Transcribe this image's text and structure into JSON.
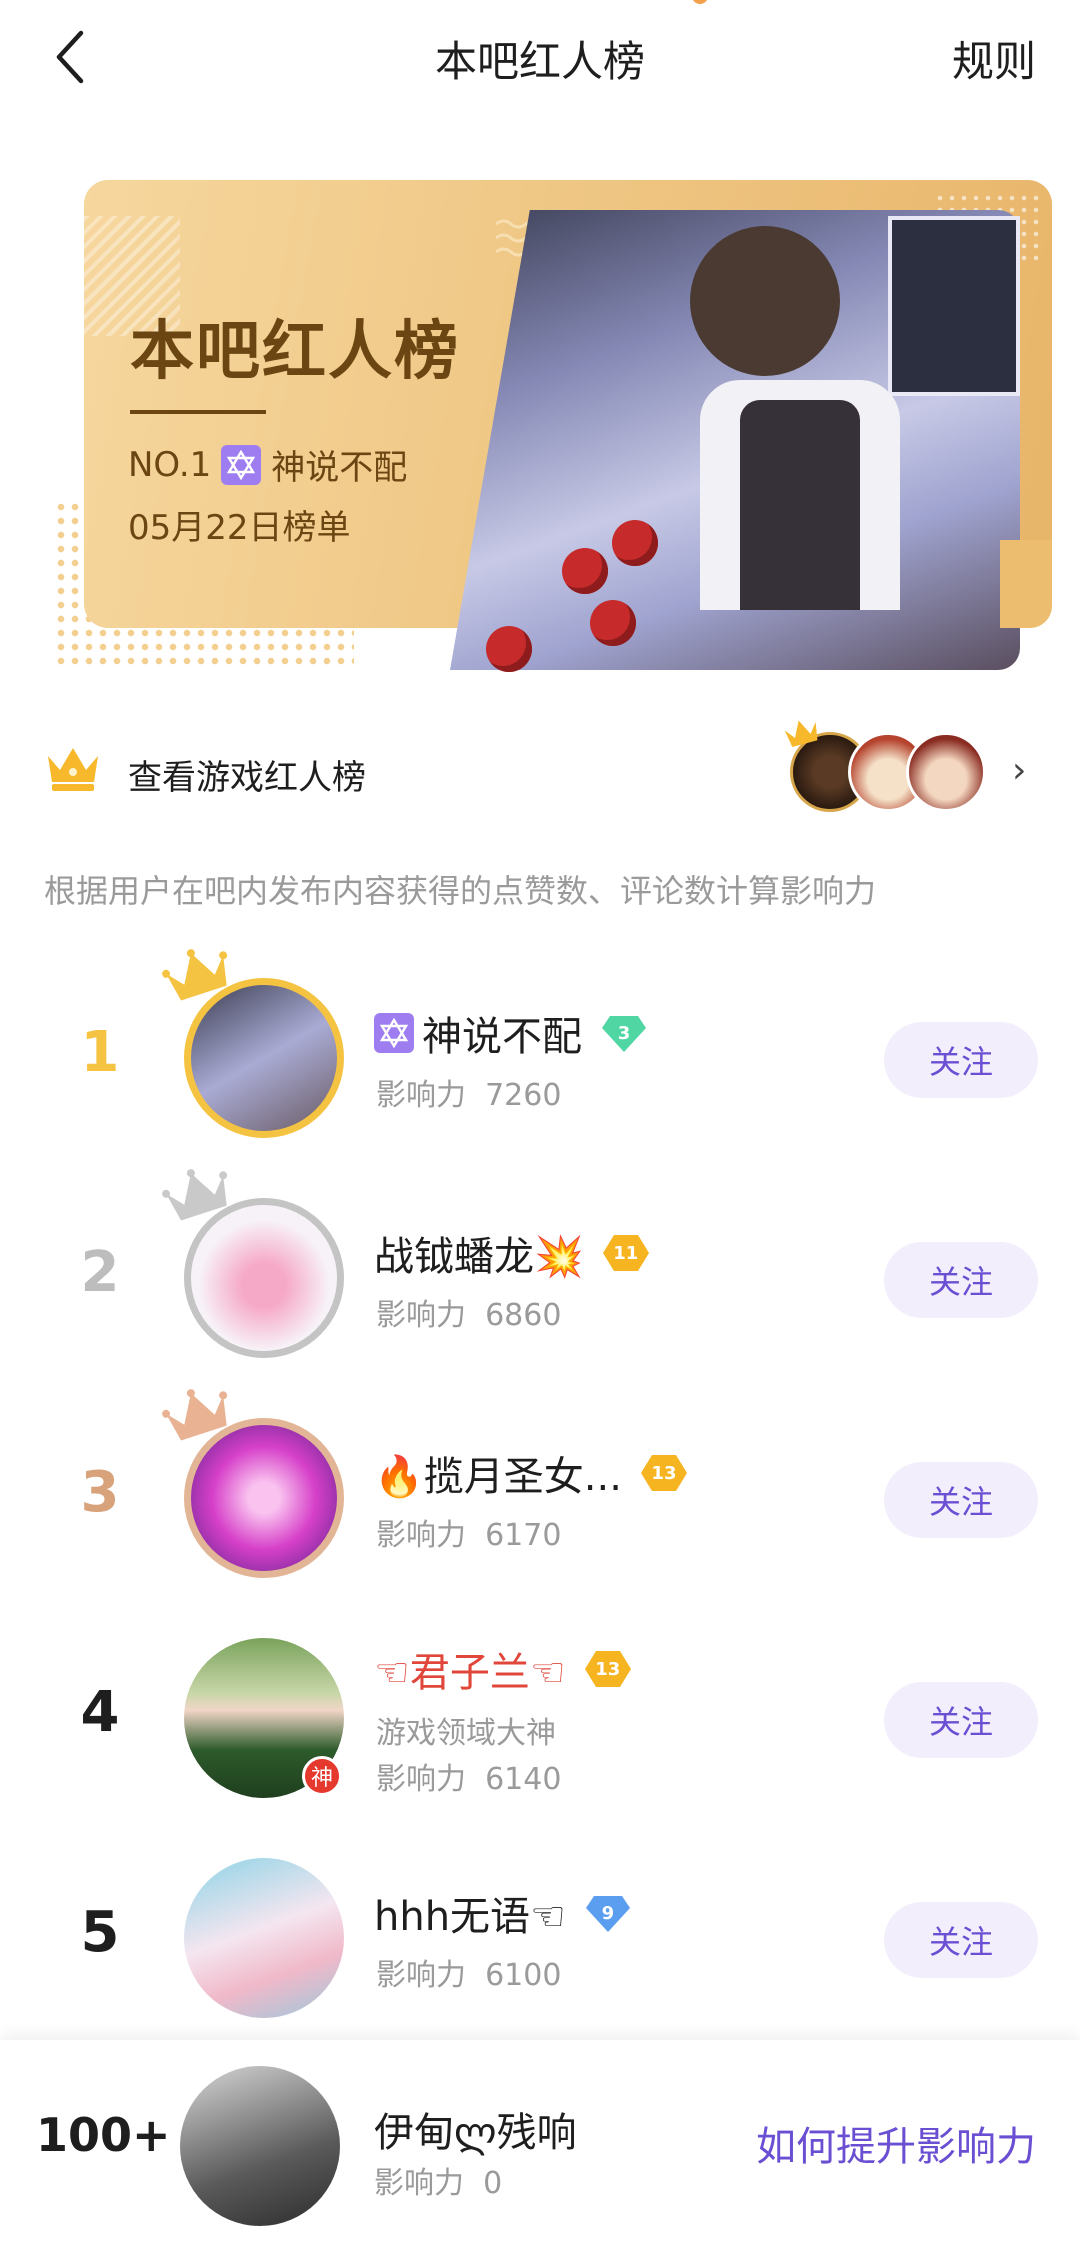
{
  "header": {
    "title": "本吧红人榜",
    "rules_label": "规则"
  },
  "banner": {
    "title": "本吧红人榜",
    "no1_prefix": "NO.1",
    "no1_name": "神说不配",
    "date": "05月22日榜单"
  },
  "game_rank": {
    "label": "查看游戏红人榜"
  },
  "description": "根据用户在吧内发布内容获得的点赞数、评论数计算影响力",
  "follow_label": "关注",
  "influence_label": "影响力",
  "ranking": [
    {
      "rank": "1",
      "name": "神说不配",
      "level": "3",
      "score": "7260",
      "rank_color": "#f5c342"
    },
    {
      "rank": "2",
      "name": "战钺蟠龙💥",
      "level": "11",
      "score": "6860",
      "rank_color": "#bdbdbd"
    },
    {
      "rank": "3",
      "name": "🔥揽月圣女...",
      "level": "13",
      "score": "6170",
      "rank_color": "#d8a27a"
    },
    {
      "rank": "4",
      "name": "☜君子兰☜",
      "level": "13",
      "title": "游戏领域大神",
      "score": "6140",
      "god_badge": "神",
      "rank_color": "#1e1e1e"
    },
    {
      "rank": "5",
      "name": "hhh无语☜",
      "level": "9",
      "score": "6100",
      "rank_color": "#1e1e1e"
    }
  ],
  "me": {
    "rank": "100+",
    "name": "伊甸ლ残响",
    "score": "0",
    "improve_label": "如何提升影响力"
  },
  "colors": {
    "accent": "#6b4fd3",
    "gold": "#f5c342",
    "banner": "#efc785"
  }
}
